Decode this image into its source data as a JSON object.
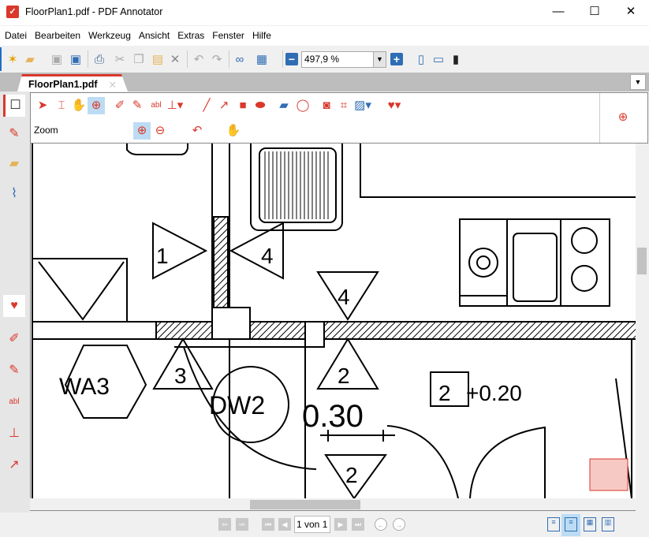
{
  "window": {
    "title": "FloorPlan1.pdf - PDF Annotator",
    "minimize": "—",
    "maximize": "☐",
    "close": "✕"
  },
  "menu": [
    "Datei",
    "Bearbeiten",
    "Werkzeug",
    "Ansicht",
    "Extras",
    "Fenster",
    "Hilfe"
  ],
  "toolbar": {
    "zoom_value": "497,9 %",
    "zoom_out": "−",
    "zoom_in": "+"
  },
  "tab": {
    "label": "FloorPlan1.pdf",
    "close": "✕"
  },
  "annotation_toolbar": {
    "mode_label": "Zoom"
  },
  "floorplan": {
    "labels": [
      "1",
      "4",
      "4",
      "WA3",
      "3",
      "DW2",
      "2",
      "0.30",
      "2",
      "+0.20",
      "2"
    ]
  },
  "status": {
    "page": "1 von 1"
  },
  "colors": {
    "accent": "#d9382b",
    "blue": "#2f6db5",
    "active": "#bcdcf4"
  }
}
